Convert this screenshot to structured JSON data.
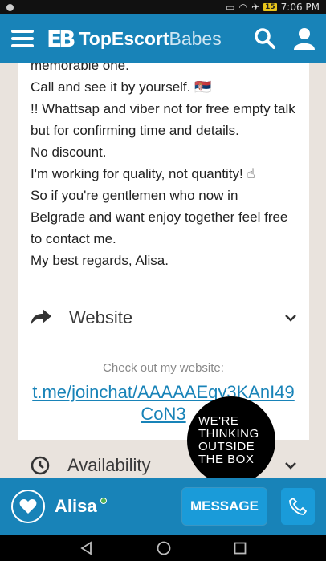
{
  "status_bar": {
    "time": "7:06 PM",
    "battery": "15"
  },
  "header": {
    "logo_mark": "EB",
    "logo_bold": "TopEscort",
    "logo_light": "Babes",
    "menu_icon": "hamburger-icon",
    "search_icon": "search-icon",
    "account_icon": "user-icon"
  },
  "description": {
    "lines": [
      "memorable one.",
      "Call and see it by yourself. 🇷🇸",
      "!! Whattsap and viber not for free empty talk but for confirming time and details.",
      "No discount.",
      "I'm working for quality, not quantity! ☝",
      "So if you're gentlemen who now in Belgrade and want enjoy together feel free to contact me.",
      "My best regards, Alisa."
    ]
  },
  "website_section": {
    "label": "Website",
    "caption": "Check out my website:",
    "link": "t.me/joinchat/AAAAAEqy3KAnI49CoN3"
  },
  "availability_section": {
    "label": "Availability"
  },
  "badge": {
    "lines": [
      "WE'RE",
      "THINKING",
      "OUTSIDE",
      "THE BOX"
    ]
  },
  "bottom_bar": {
    "name": "Alisa",
    "message_label": "MESSAGE"
  },
  "colors": {
    "brand_blue": "#1883b8",
    "button_blue": "#1a9bd9",
    "page_bg": "#e9e3dd",
    "online_green": "#4caf50"
  }
}
